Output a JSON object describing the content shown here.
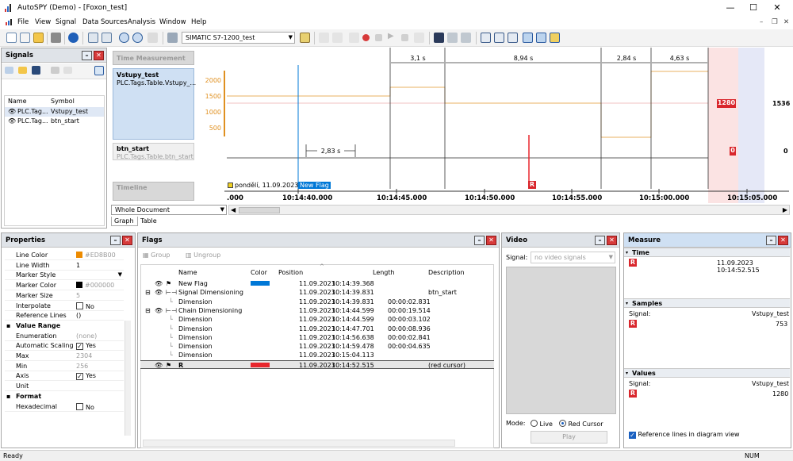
{
  "window": {
    "title": "AutoSPY (Demo) - [Foxon_test]",
    "minimize": "—",
    "maximize": "☐",
    "close": "✕"
  },
  "menu": {
    "items": [
      "File",
      "View",
      "Signal",
      "Data Sources",
      "Analysis",
      "Window",
      "Help"
    ],
    "mdi": [
      "–",
      "❐",
      "✕"
    ]
  },
  "toolbar": {
    "device": "SIMATIC S7-1200_test"
  },
  "signals_panel": {
    "title": "Signals",
    "col_name": "Name",
    "col_symbol": "Symbol",
    "rows": [
      {
        "name": "PLC.Tag...",
        "symbol": "Vstupy_test"
      },
      {
        "name": "PLC.Tag...",
        "symbol": "btn_start"
      }
    ]
  },
  "plot": {
    "time_measurement": "Time Measurement",
    "sig1_name": "Vstupy_test",
    "sig1_path": "PLC.Tags.Table.Vstupy_...",
    "sig2_name": "btn_start",
    "sig2_path": "PLC.Tags.Table.btn_start",
    "timeline": "Timeline",
    "y_ticks": [
      "2000",
      "1500",
      "1000",
      "500"
    ],
    "sig1_color": "#E8B060",
    "flag_color": "#0078D7",
    "cursor_color": "#E8262C",
    "dims_top": [
      "3,1 s",
      "8,94 s",
      "2,84 s",
      "4,63 s"
    ],
    "dim_bottom": "2,83 s",
    "date_label": "pondělí, 11.09.2023",
    "flag_label": "New Flag",
    "cursor_label": "R",
    "cursor_val1": "1280",
    "cursor_val2": "0",
    "right_val1": "1536",
    "right_val2": "0",
    "x_ticks": [
      ".000",
      "10:14:40.000",
      "10:14:45.000",
      "10:14:50.000",
      "10:14:55.000",
      "10:15:00.000",
      "10:15:05.000"
    ],
    "scope": "Whole Document",
    "tab_graph": "Graph",
    "tab_table": "Table"
  },
  "properties": {
    "title": "Properties",
    "rows": [
      {
        "label": "Line Color",
        "value": "#ED8B00",
        "swatch": "#ED8B00",
        "dim": true
      },
      {
        "label": "Line Width",
        "value": "1"
      },
      {
        "label": "Marker Style",
        "value": ""
      },
      {
        "label": "Marker Color",
        "value": "#000000",
        "swatch": "#000000",
        "dim": true
      },
      {
        "label": "Marker Size",
        "value": "5",
        "dim": true
      },
      {
        "label": "Interpolate",
        "value": "No",
        "check": false
      },
      {
        "label": "Reference Lines",
        "value": "()"
      }
    ],
    "section_value_range": "Value Range",
    "rows2": [
      {
        "label": "Enumeration",
        "value": "(none)",
        "dim": true
      },
      {
        "label": "Automatic Scaling",
        "value": "Yes",
        "check": true
      },
      {
        "label": "Max",
        "value": "2304",
        "dim": true
      },
      {
        "label": "Min",
        "value": "256",
        "dim": true
      },
      {
        "label": "Axis",
        "value": "Yes",
        "check": true
      },
      {
        "label": "Unit",
        "value": ""
      }
    ],
    "section_format": "Format",
    "rows3": [
      {
        "label": "Hexadecimal",
        "value": "No",
        "check": false
      }
    ]
  },
  "flags": {
    "title": "Flags",
    "group_btn": "Group",
    "ungroup_btn": "Ungroup",
    "col_name": "Name",
    "col_color": "Color",
    "col_position": "Position",
    "col_length": "Length",
    "col_description": "Description",
    "rows": [
      {
        "name": "New Flag",
        "color": "#0078D7",
        "date": "11.09.2023",
        "time": "10:14:39.368",
        "length": "",
        "desc": "",
        "indent": 0
      },
      {
        "name": "Signal Dimensioning",
        "color": "",
        "date": "11.09.2023",
        "time": "10:14:39.831",
        "length": "",
        "desc": "btn_start",
        "indent": 0
      },
      {
        "name": "Dimension",
        "color": "",
        "date": "11.09.2023",
        "time": "10:14:39.831",
        "length": "00:00:02.831",
        "desc": "",
        "indent": 1
      },
      {
        "name": "Chain Dimensioning",
        "color": "",
        "date": "11.09.2023",
        "time": "10:14:44.599",
        "length": "00:00:19.514",
        "desc": "",
        "indent": 0
      },
      {
        "name": "Dimension",
        "color": "",
        "date": "11.09.2023",
        "time": "10:14:44.599",
        "length": "00:00:03.102",
        "desc": "",
        "indent": 1
      },
      {
        "name": "Dimension",
        "color": "",
        "date": "11.09.2023",
        "time": "10:14:47.701",
        "length": "00:00:08.936",
        "desc": "",
        "indent": 1
      },
      {
        "name": "Dimension",
        "color": "",
        "date": "11.09.2023",
        "time": "10:14:56.638",
        "length": "00:00:02.841",
        "desc": "",
        "indent": 1
      },
      {
        "name": "Dimension",
        "color": "",
        "date": "11.09.2023",
        "time": "10:14:59.478",
        "length": "00:00:04.635",
        "desc": "",
        "indent": 1
      },
      {
        "name": "Dimension",
        "color": "",
        "date": "11.09.2023",
        "time": "10:15:04.113",
        "length": "",
        "desc": "",
        "indent": 1
      },
      {
        "name": "R",
        "color": "#E8262C",
        "date": "11.09.2023",
        "time": "10:14:52.515",
        "length": "",
        "desc": "(red cursor)",
        "indent": 0
      }
    ]
  },
  "video": {
    "title": "Video",
    "signal_label": "Signal:",
    "signal_value": "no video signals",
    "mode_label": "Mode:",
    "mode_live": "Live",
    "mode_red": "Red Cursor",
    "play": "Play"
  },
  "measure": {
    "title": "Measure",
    "time_hdr": "Time",
    "time_badge": "R",
    "time_value": "11.09.2023  10:14:52.515",
    "samples_hdr": "Samples",
    "samples_signal_label": "Signal:",
    "samples_signal": "Vstupy_test",
    "samples_badge": "R",
    "samples_value": "753",
    "values_hdr": "Values",
    "values_signal_label": "Signal:",
    "values_signal": "Vstupy_test",
    "values_badge": "R",
    "values_value": "1280",
    "ref_lines": "Reference lines in diagram view"
  },
  "status": {
    "left": "Ready",
    "right": "NUM"
  }
}
